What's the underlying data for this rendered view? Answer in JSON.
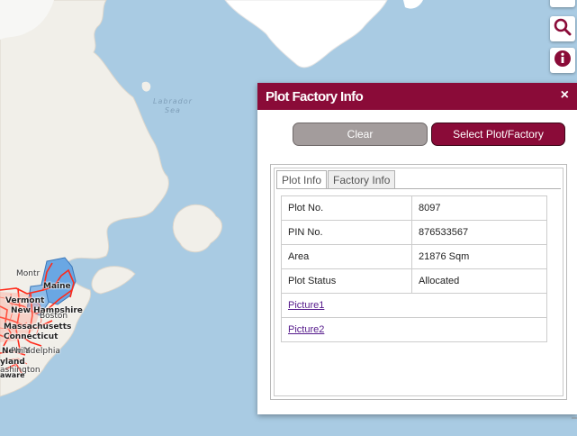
{
  "map": {
    "sea_label_line1": "Labrador",
    "sea_label_line2": "Sea",
    "labels": {
      "montreal": "Montr",
      "maine": "Maine",
      "vermont": "Vermont",
      "new_hampshire": "New Hampshire",
      "boston": "Boston",
      "massachusetts": "Massachusetts",
      "connecticut": "Connecticut",
      "new_york": "New Y",
      "philadelphia": "Philadelphia",
      "maryland": "yland",
      "washington": "ashington",
      "delaware": "aware"
    },
    "colors": {
      "water": "#a9cbe3",
      "land": "#f1efe9",
      "ice": "#ffffff",
      "route": "#ff2a1a",
      "selection": "#6aa7e3"
    }
  },
  "toolbar": {
    "items": [
      {
        "icon": "grid-icon"
      },
      {
        "icon": "search-icon"
      },
      {
        "icon": "info-icon"
      }
    ],
    "accent": "#8a0b38"
  },
  "dialog": {
    "title": "Plot Factory Info",
    "close_glyph": "×",
    "clear_label": "Clear",
    "select_label": "Select Plot/Factory",
    "tabs": [
      {
        "label": "Plot Info",
        "active": true
      },
      {
        "label": "Factory Info",
        "active": false
      }
    ],
    "rows": [
      {
        "label": "Plot No.",
        "value": "8097"
      },
      {
        "label": "PIN No.",
        "value": "876533567"
      },
      {
        "label": "Area",
        "value": "21876 Sqm"
      },
      {
        "label": "Plot Status",
        "value": "Allocated"
      }
    ],
    "links": [
      {
        "label": "Picture1"
      },
      {
        "label": "Picture2"
      }
    ]
  }
}
